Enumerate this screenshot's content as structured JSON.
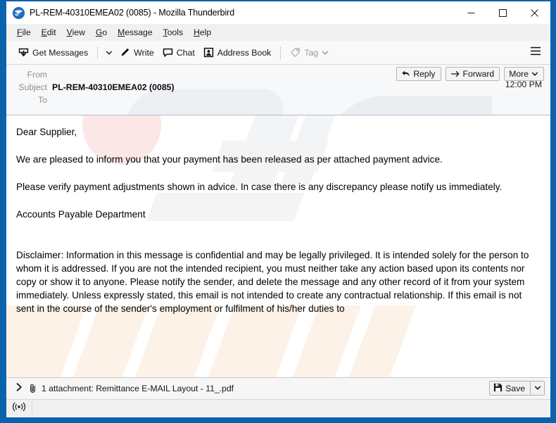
{
  "window": {
    "title": "PL-REM-40310EMEA02 (0085) - Mozilla Thunderbird",
    "app_icon": "thunderbird-icon",
    "controls": {
      "minimize": "minimize-icon",
      "maximize": "maximize-icon",
      "close": "close-icon"
    },
    "frame_color": "#0b63ad"
  },
  "menubar": {
    "items": [
      {
        "label": "File",
        "accel": "F"
      },
      {
        "label": "Edit",
        "accel": "E"
      },
      {
        "label": "View",
        "accel": "V"
      },
      {
        "label": "Go",
        "accel": "G"
      },
      {
        "label": "Message",
        "accel": "M"
      },
      {
        "label": "Tools",
        "accel": "T"
      },
      {
        "label": "Help",
        "accel": "H"
      }
    ]
  },
  "toolbar": {
    "get_messages_label": "Get Messages",
    "write_label": "Write",
    "chat_label": "Chat",
    "address_book_label": "Address Book",
    "tag_label": "Tag",
    "app_menu": "hamburger-icon"
  },
  "message_header": {
    "from_label": "From",
    "from_value": "",
    "subject_label": "Subject",
    "subject_value": "PL-REM-40310EMEA02 (0085)",
    "to_label": "To",
    "to_value": "",
    "time": "12:00 PM",
    "actions": {
      "reply_label": "Reply",
      "forward_label": "Forward",
      "more_label": "More"
    }
  },
  "body": {
    "greeting": "Dear Supplier,",
    "paragraph1": "We are pleased to inform you that your payment has been released as per attached payment advice.",
    "paragraph2": "Please verify payment adjustments shown in advice. In case there is any discrepancy please notify us immediately.",
    "signature": "Accounts Payable Department",
    "disclaimer": "Disclaimer: Information in this message is confidential and may be legally privileged. It is intended solely for the person to whom it is addressed. If you are not the intended recipient, you must neither take any action based upon its contents nor copy or show it to anyone. Please notify the sender, and delete the message and any other record of it from your system immediately. Unless expressly stated, this email is not intended to create any contractual relationship. If this email is not sent in the course of the sender's employment or fulfilment of his/her duties to"
  },
  "attachment": {
    "expander_icon": "chevron-right-icon",
    "clip_icon": "paperclip-icon",
    "text": "1 attachment: Remittance E-MAIL Layout - 11_.pdf",
    "save_label": "Save",
    "save_icon": "save-disk-icon",
    "save_dropdown_icon": "chevron-down-icon"
  },
  "statusbar": {
    "broadcast_icon": "broadcast-icon"
  }
}
